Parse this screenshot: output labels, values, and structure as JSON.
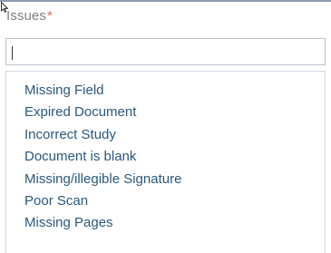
{
  "field": {
    "label": "Issues",
    "required_mark": "*",
    "input_value": ""
  },
  "dropdown": {
    "options": [
      {
        "label": "Missing Field"
      },
      {
        "label": "Expired Document"
      },
      {
        "label": "Incorrect Study"
      },
      {
        "label": "Document is blank"
      },
      {
        "label": "Missing/illegible Signature"
      },
      {
        "label": "Poor Scan"
      },
      {
        "label": "Missing Pages"
      }
    ]
  },
  "colors": {
    "label_text": "#7f7f7f",
    "required_mark": "#e06666",
    "option_text": "#2a587d",
    "input_border": "#b9c3ce"
  },
  "icons": {
    "cursor": "mouse-pointer-icon"
  }
}
